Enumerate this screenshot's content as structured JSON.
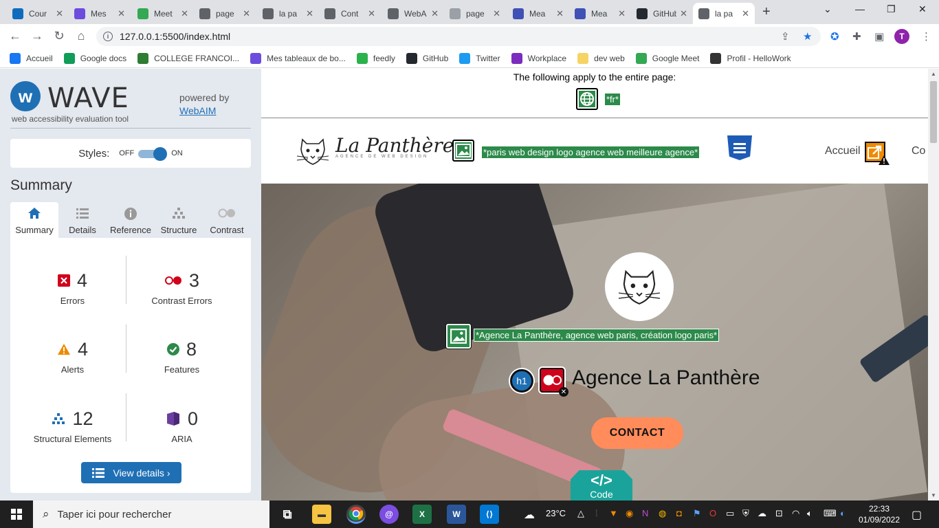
{
  "browser": {
    "tabs": [
      {
        "title": "Cour",
        "icon": "outlook-icon",
        "color": "#0f6cbd"
      },
      {
        "title": "Mes",
        "icon": "notion-icon",
        "color": "#6c4cdc"
      },
      {
        "title": "Meet",
        "icon": "meet-icon",
        "color": "#34a853"
      },
      {
        "title": "page",
        "icon": "globe-icon",
        "color": "#5f6368"
      },
      {
        "title": "la pa",
        "icon": "globe-icon",
        "color": "#5f6368"
      },
      {
        "title": "Cont",
        "icon": "globe-icon",
        "color": "#5f6368"
      },
      {
        "title": "WebA",
        "icon": "webaim-icon",
        "color": "#5f6368"
      },
      {
        "title": "page",
        "icon": "image-icon",
        "color": "#9aa0a6"
      },
      {
        "title": "Mea",
        "icon": "azure-icon",
        "color": "#3f51b5"
      },
      {
        "title": "Mea",
        "icon": "azure-icon",
        "color": "#3f51b5"
      },
      {
        "title": "GitHub",
        "icon": "github-icon",
        "color": "#24292f"
      },
      {
        "title": "la pa",
        "icon": "globe-icon",
        "color": "#5f6368",
        "active": true
      }
    ],
    "url": "127.0.0.1:5500/index.html",
    "profile_initial": "T",
    "bookmarks": [
      {
        "label": "Accueil",
        "icon": "facebook-icon",
        "color": "#1877f2"
      },
      {
        "label": "Google docs",
        "icon": "docs-icon",
        "color": "#0f9d58"
      },
      {
        "label": "COLLEGE FRANCOI...",
        "icon": "college-icon",
        "color": "#2e7d32"
      },
      {
        "label": "Mes tableaux de bo...",
        "icon": "notion-icon",
        "color": "#6c4cdc"
      },
      {
        "label": "feedly",
        "icon": "feedly-icon",
        "color": "#2bb24c"
      },
      {
        "label": "GitHub",
        "icon": "github-icon",
        "color": "#24292f"
      },
      {
        "label": "Twitter",
        "icon": "twitter-icon",
        "color": "#1d9bf0"
      },
      {
        "label": "Workplace",
        "icon": "workplace-icon",
        "color": "#7b2cbf"
      },
      {
        "label": "dev web",
        "icon": "folder-icon",
        "color": "#f6d365"
      },
      {
        "label": "Google Meet",
        "icon": "meet-icon",
        "color": "#34a853"
      },
      {
        "label": "Profil - HelloWork",
        "icon": "hellowork-icon",
        "color": "#333333"
      }
    ]
  },
  "wave": {
    "logo_text": "WAVE",
    "subtitle": "web accessibility evaluation tool",
    "powered_by": "powered by",
    "webaim_link": "WebAIM",
    "styles_label": "Styles:",
    "styles_off": "OFF",
    "styles_on": "ON",
    "summary_heading": "Summary",
    "tabs": [
      "Summary",
      "Details",
      "Reference",
      "Structure",
      "Contrast"
    ],
    "stats": {
      "errors": {
        "value": "4",
        "label": "Errors"
      },
      "contrast_errors": {
        "value": "3",
        "label": "Contrast Errors"
      },
      "alerts": {
        "value": "4",
        "label": "Alerts"
      },
      "features": {
        "value": "8",
        "label": "Features"
      },
      "structural": {
        "value": "12",
        "label": "Structural Elements"
      },
      "aria": {
        "value": "0",
        "label": "ARIA"
      }
    },
    "view_details": "View details ›",
    "colors": {
      "accent": "#1f6fb5",
      "error": "#d0021b",
      "alert": "#f08a00",
      "feature": "#2c8a4a",
      "aria": "#6b3fa0"
    }
  },
  "page": {
    "apply_text": "The following apply to the entire page:",
    "lang_tag": "*fr*",
    "brand": "La Panthère",
    "brand_sub": "AGENCE DE WEB DESIGN",
    "logo_alt_tag": "*paris web design logo agence web meilleure agence*",
    "nav_accueil": "Accueil",
    "nav_next": "Co",
    "hero_alt_tag": "*Agence La Panthère, agence web paris, création logo paris*",
    "h1_badge": "h1",
    "h1_text": "Agence La Panthère",
    "contact_button": "CONTACT",
    "code_label": "Code",
    "code_symbol": "</>"
  },
  "taskbar": {
    "search_placeholder": "Taper ici pour rechercher",
    "weather": "23°C",
    "time": "22:33",
    "date": "01/09/2022"
  }
}
